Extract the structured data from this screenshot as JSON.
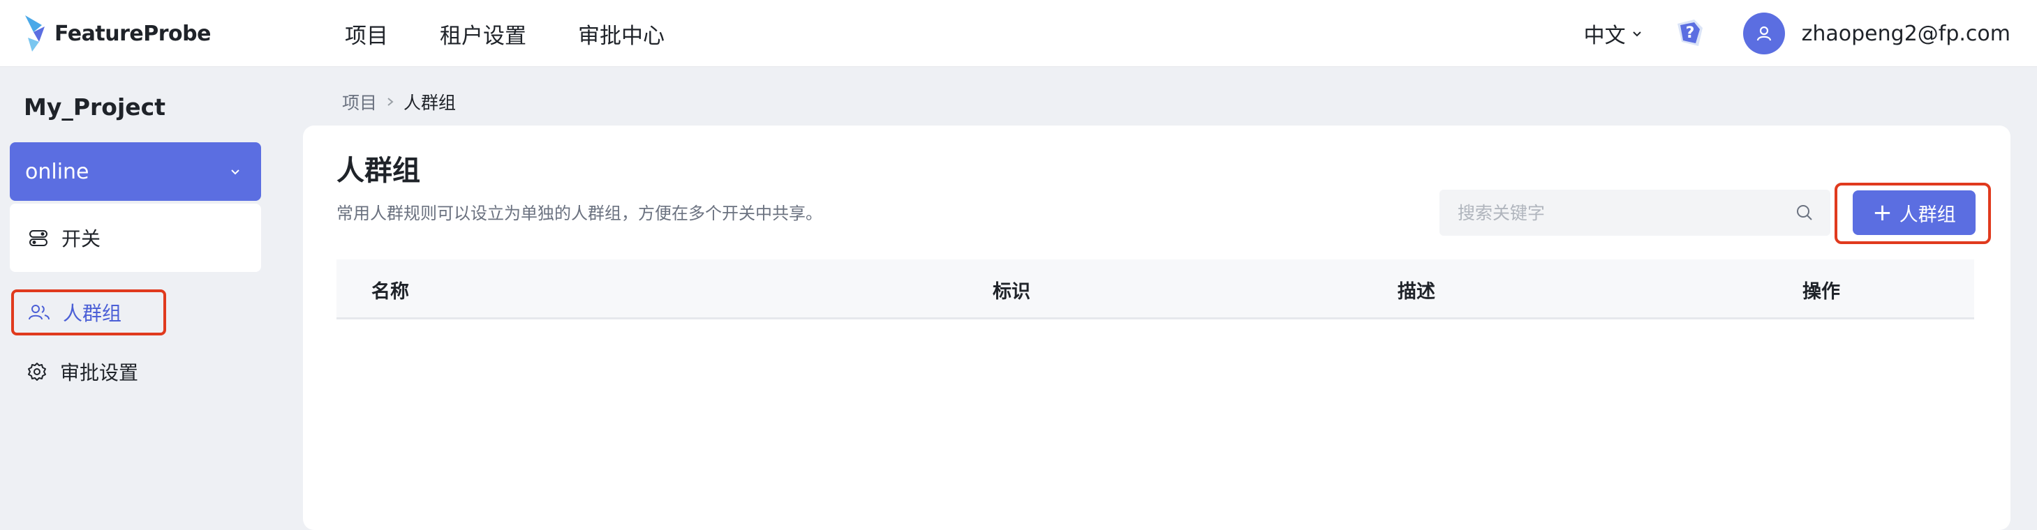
{
  "header": {
    "logo_text": "FeatureProbe",
    "nav": [
      "项目",
      "租户设置",
      "审批中心"
    ],
    "language": "中文",
    "user_email": "zhaopeng2@fp.com"
  },
  "sidebar": {
    "project_name": "My_Project",
    "environment": "online",
    "items": [
      {
        "label": "开关",
        "icon": "toggle-icon"
      },
      {
        "label": "人群组",
        "icon": "users-icon",
        "active": true
      },
      {
        "label": "审批设置",
        "icon": "gear-icon"
      }
    ]
  },
  "breadcrumb": {
    "parent": "项目",
    "current": "人群组"
  },
  "main": {
    "title": "人群组",
    "description": "常用人群规则可以设立为单独的人群组，方便在多个开关中共享。",
    "search_placeholder": "搜索关键字",
    "add_button_label": "人群组",
    "table_headers": [
      "名称",
      "标识",
      "描述",
      "操作"
    ]
  },
  "colors": {
    "accent": "#5b6ee1",
    "highlight_border": "#e03a1e",
    "background": "#eef0f4"
  }
}
